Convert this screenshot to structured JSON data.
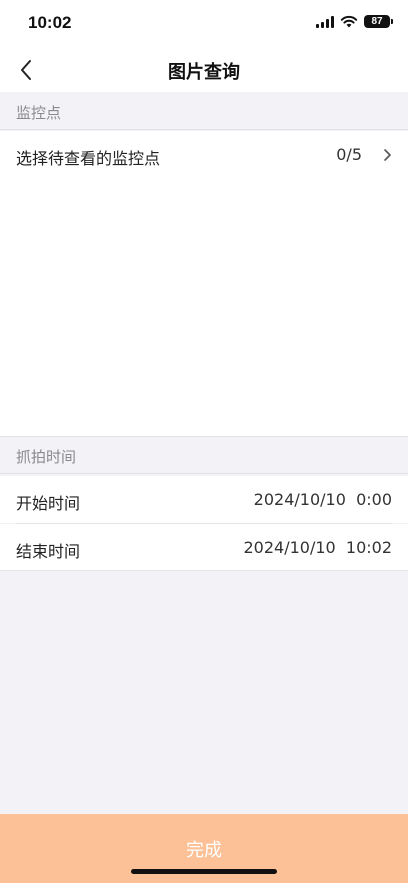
{
  "status_bar": {
    "time": "10:02",
    "battery": "87",
    "icons": [
      "signal-icon",
      "wifi-icon",
      "battery-icon"
    ]
  },
  "nav": {
    "title": "图片查询",
    "back_icon": "chevron-left-icon"
  },
  "monitor_section": {
    "header": "监控点",
    "row": {
      "label": "选择待查看的监控点",
      "value": "0/5",
      "icon": "chevron-right-icon"
    }
  },
  "capture_section": {
    "header": "抓拍时间",
    "start": {
      "label": "开始时间",
      "value": "2024/10/10  0:00"
    },
    "end": {
      "label": "结束时间",
      "value": "2024/10/10  10:02"
    }
  },
  "footer": {
    "done_label": "完成"
  },
  "colors": {
    "background": "#f2f2f7",
    "done_button": "#fcc197",
    "section_header_text": "#8a8a8e"
  }
}
